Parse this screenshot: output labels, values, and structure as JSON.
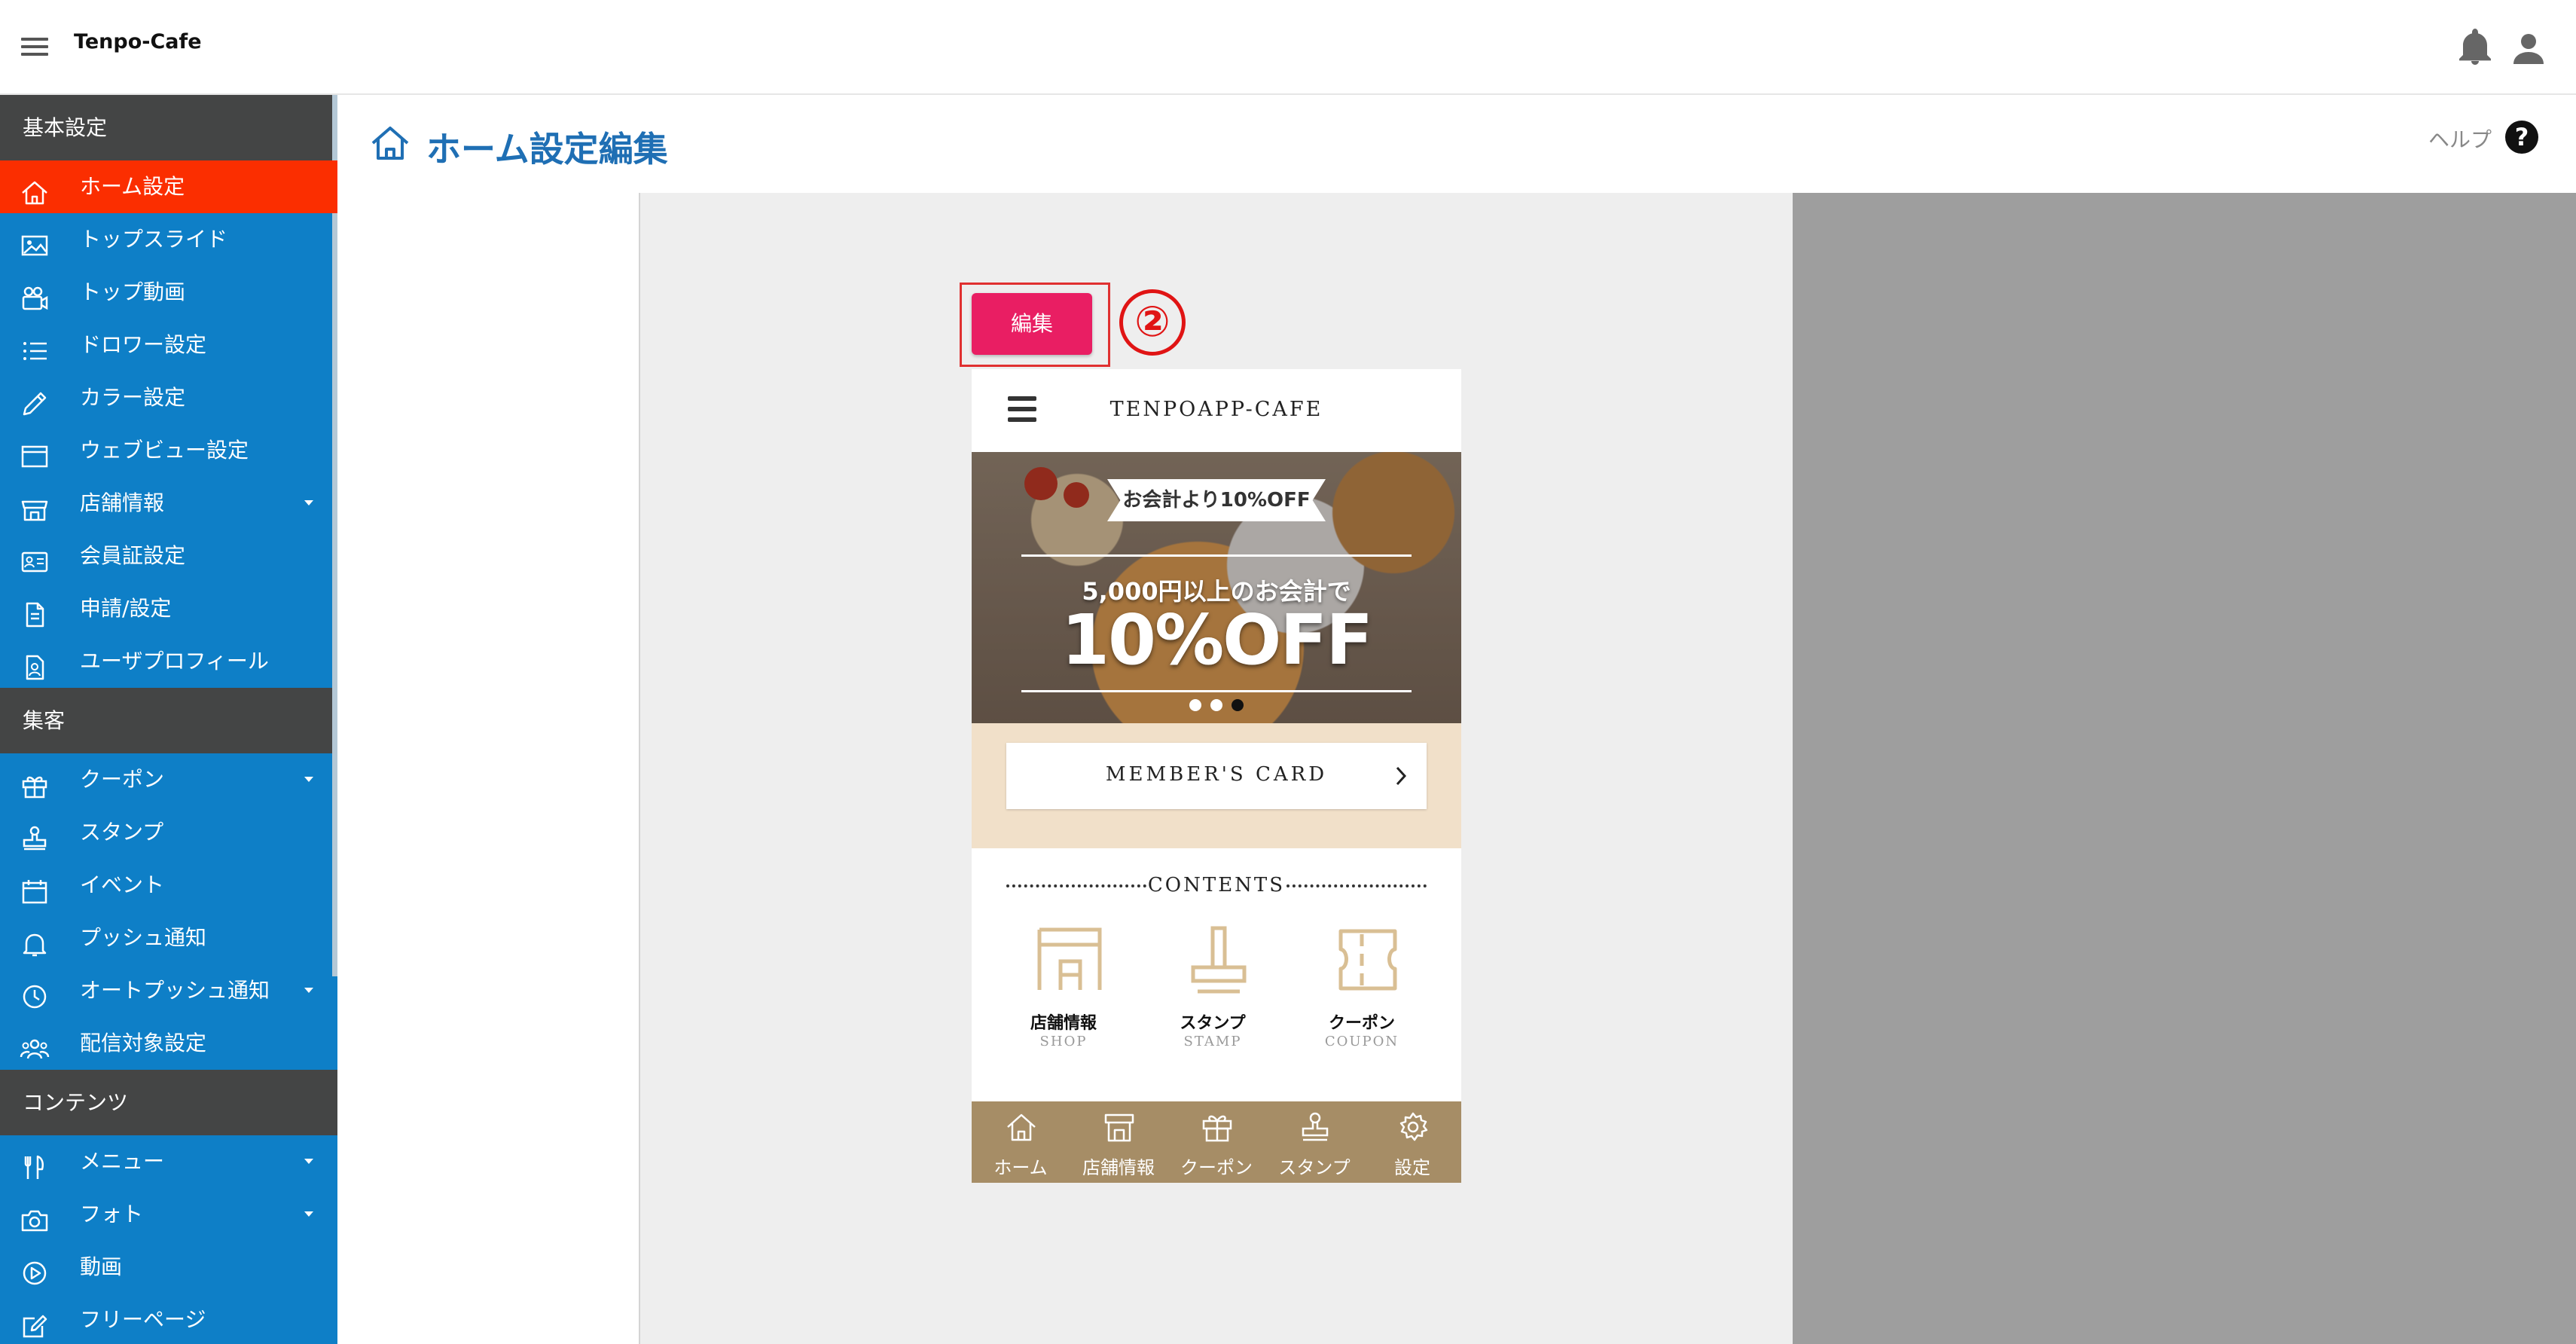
{
  "app": {
    "title": "Tenpo-Cafe"
  },
  "header_icons": [
    "bell-icon",
    "person-icon"
  ],
  "sidebar": {
    "sections": [
      {
        "title": "基本設定",
        "items": [
          {
            "label": "ホーム設定",
            "icon": "home-icon",
            "active": true
          },
          {
            "label": "トップスライド",
            "icon": "image-icon"
          },
          {
            "label": "トップ動画",
            "icon": "video-camera-icon"
          },
          {
            "label": "ドロワー設定",
            "icon": "list-icon"
          },
          {
            "label": "カラー設定",
            "icon": "pencil-icon"
          },
          {
            "label": "ウェブビュー設定",
            "icon": "browser-window-icon"
          },
          {
            "label": "店舗情報",
            "icon": "store-icon",
            "expandable": true
          },
          {
            "label": "会員証設定",
            "icon": "id-card-icon"
          },
          {
            "label": "申請/設定",
            "icon": "document-icon"
          },
          {
            "label": "ユーザプロフィール",
            "icon": "user-profile-icon"
          }
        ]
      },
      {
        "title": "集客",
        "items": [
          {
            "label": "クーポン",
            "icon": "gift-icon",
            "expandable": true
          },
          {
            "label": "スタンプ",
            "icon": "stamp-icon"
          },
          {
            "label": "イベント",
            "icon": "calendar-icon"
          },
          {
            "label": "プッシュ通知",
            "icon": "bell-icon"
          },
          {
            "label": "オートプッシュ通知",
            "icon": "clock-icon",
            "expandable": true
          },
          {
            "label": "配信対象設定",
            "icon": "users-icon"
          }
        ]
      },
      {
        "title": "コンテンツ",
        "items": [
          {
            "label": "メニュー",
            "icon": "fork-knife-icon",
            "expandable": true
          },
          {
            "label": "フォト",
            "icon": "camera-icon",
            "expandable": true
          },
          {
            "label": "動画",
            "icon": "play-circle-icon"
          },
          {
            "label": "フリーページ",
            "icon": "edit-icon"
          }
        ]
      }
    ]
  },
  "page": {
    "title": "ホーム設定編集",
    "help_label": "ヘルプ",
    "help_symbol": "?"
  },
  "editor": {
    "edit_button": "編集",
    "step_marker": "②"
  },
  "preview": {
    "app_name": "TENPOAPP-CAFE",
    "slide": {
      "ribbon": "お会計より10%OFF",
      "subtitle": "5,000円以上のお会計で",
      "headline": "10%OFF",
      "dots_count": 3,
      "active_dot_index": 2
    },
    "member_card_label": "MEMBER'S CARD",
    "contents_title": "CONTENTS",
    "tiles": [
      {
        "label": "店舗情報",
        "sub": "SHOP",
        "icon": "shop-icon"
      },
      {
        "label": "スタンプ",
        "sub": "STAMP",
        "icon": "stamp-icon"
      },
      {
        "label": "クーポン",
        "sub": "COUPON",
        "icon": "coupon-ticket-icon"
      }
    ],
    "tabbar": [
      {
        "label": "ホーム",
        "icon": "home-icon"
      },
      {
        "label": "店舗情報",
        "icon": "store-icon"
      },
      {
        "label": "クーポン",
        "icon": "gift-icon"
      },
      {
        "label": "スタンプ",
        "icon": "stamp-icon"
      },
      {
        "label": "設定",
        "icon": "gear-icon"
      }
    ]
  },
  "colors": {
    "sidebar_bg": "#0e7fc7",
    "sidebar_section_bg": "#444545",
    "sidebar_active": "#fb2e00",
    "title_blue": "#1f6fb4",
    "edit_button": "#e91e63",
    "callout_red": "#e03030",
    "tabbar_brown": "#a68d66",
    "member_band": "#f1e0c9",
    "tile_icon": "#d9bf94"
  }
}
